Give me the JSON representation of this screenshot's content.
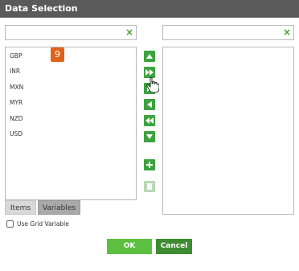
{
  "window": {
    "title": "Data Selection"
  },
  "left_search": {
    "value": "",
    "clear_icon": "×"
  },
  "right_search": {
    "value": "",
    "clear_icon": "×"
  },
  "left_list": {
    "items": [
      "GBP",
      "INR",
      "MXN",
      "MYR",
      "NZD",
      "USD"
    ],
    "badge": "9"
  },
  "right_list": {
    "items": []
  },
  "tabs": [
    {
      "label": "Items",
      "active": true
    },
    {
      "label": "Variables",
      "active": false
    }
  ],
  "grid_variable": {
    "label": "Use Grid Variable",
    "checked": false
  },
  "buttons": {
    "ok": "OK",
    "cancel": "Cancel"
  },
  "colors": {
    "titlebar": "#5a5a5a",
    "control_green": "#3ea23e",
    "ok_green": "#5cbf3f",
    "cancel_green": "#3f8b31",
    "badge_orange": "#e0631c"
  }
}
